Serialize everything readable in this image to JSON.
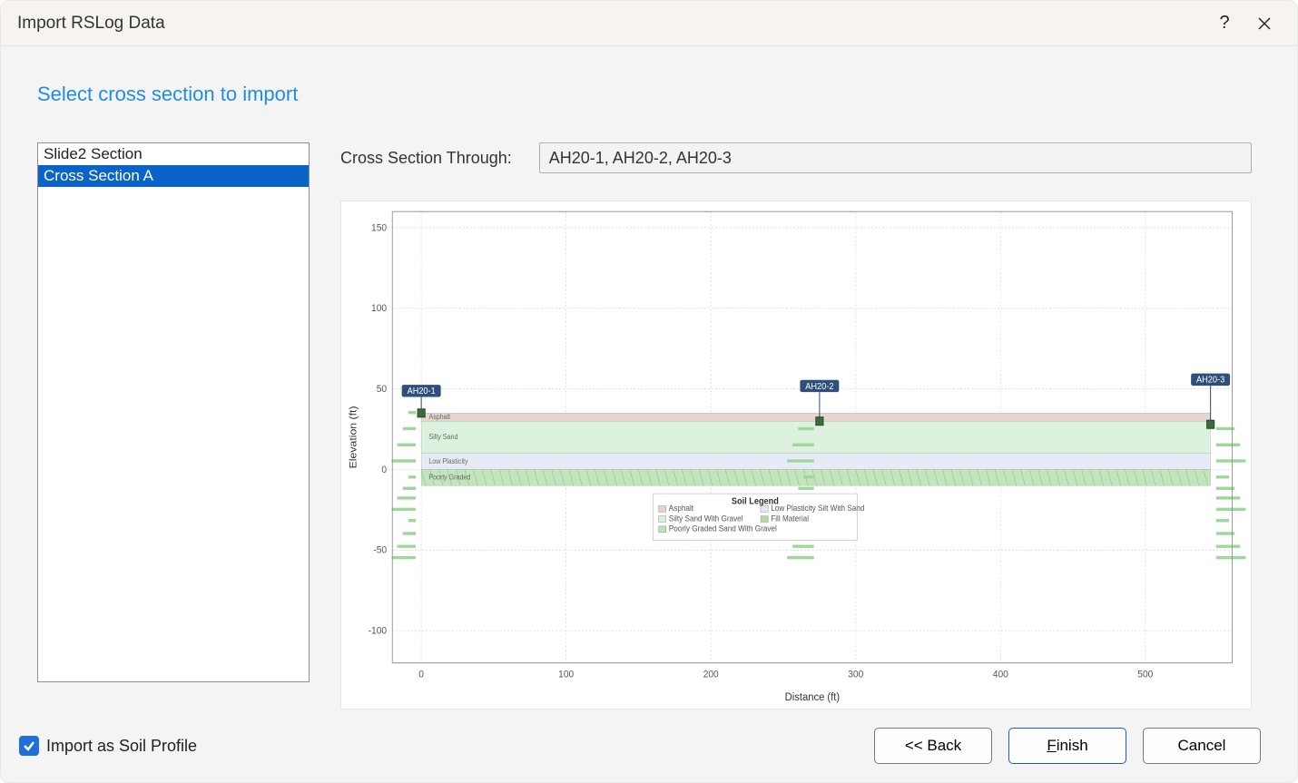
{
  "window": {
    "title": "Import RSLog Data",
    "help_tooltip": "?",
    "close_tooltip": "Close"
  },
  "heading": "Select cross section to import",
  "list": {
    "header": "Slide2 Section",
    "items": [
      "Cross Section A"
    ],
    "selected_index": 0
  },
  "through": {
    "label": "Cross Section Through:",
    "value": "AH20-1, AH20-2, AH20-3"
  },
  "checkbox": {
    "label": "Import as Soil Profile",
    "checked": true
  },
  "buttons": {
    "back": "<< Back",
    "finish": "Finish",
    "finish_mnemonic": "F",
    "cancel": "Cancel"
  },
  "chart_data": {
    "type": "cross-section",
    "xlabel": "Distance (ft)",
    "ylabel": "Elevation (ft)",
    "x_ticks": [
      0,
      100,
      200,
      300,
      400,
      500
    ],
    "y_ticks": [
      -100,
      -50,
      0,
      50,
      100,
      150
    ],
    "xlim": [
      -20,
      560
    ],
    "ylim": [
      -120,
      160
    ],
    "boreholes": [
      {
        "name": "AH20-1",
        "x": 0,
        "top_elev": 35,
        "label_elev": 45
      },
      {
        "name": "AH20-2",
        "x": 275,
        "top_elev": 30,
        "label_elev": 48
      },
      {
        "name": "AH20-3",
        "x": 545,
        "top_elev": 28,
        "label_elev": 52
      }
    ],
    "layers": [
      {
        "name": "Asphalt",
        "top_elev": 35,
        "bottom_elev": 30,
        "color": "#e6d0ca"
      },
      {
        "name": "Silty Sand With Gravel",
        "top_elev": 30,
        "bottom_elev": 10,
        "color": "#d9f0db"
      },
      {
        "name": "Low Plasticity Silt With Sand",
        "top_elev": 10,
        "bottom_elev": 0,
        "color": "#e3e9f5"
      },
      {
        "name": "Poorly Graded Sand With Gravel",
        "top_elev": 0,
        "bottom_elev": -10,
        "color": "#bde2b6"
      },
      {
        "name": "Fill Material",
        "top_elev": -10,
        "bottom_elev": -10,
        "color": "#b3d8aa"
      }
    ],
    "legend": {
      "title": "Soil Legend",
      "columns": [
        [
          "Asphalt",
          "Silty Sand With Gravel",
          "Poorly Graded Sand With Gravel"
        ],
        [
          "Low Plasticity Silt With Sand",
          "Fill Material"
        ]
      ]
    },
    "colors": {
      "grid": "#d8d8d8",
      "axis": "#888888",
      "borehole_label_bg": "#2d4f7a",
      "spt_bar": "#9ed79a"
    }
  }
}
